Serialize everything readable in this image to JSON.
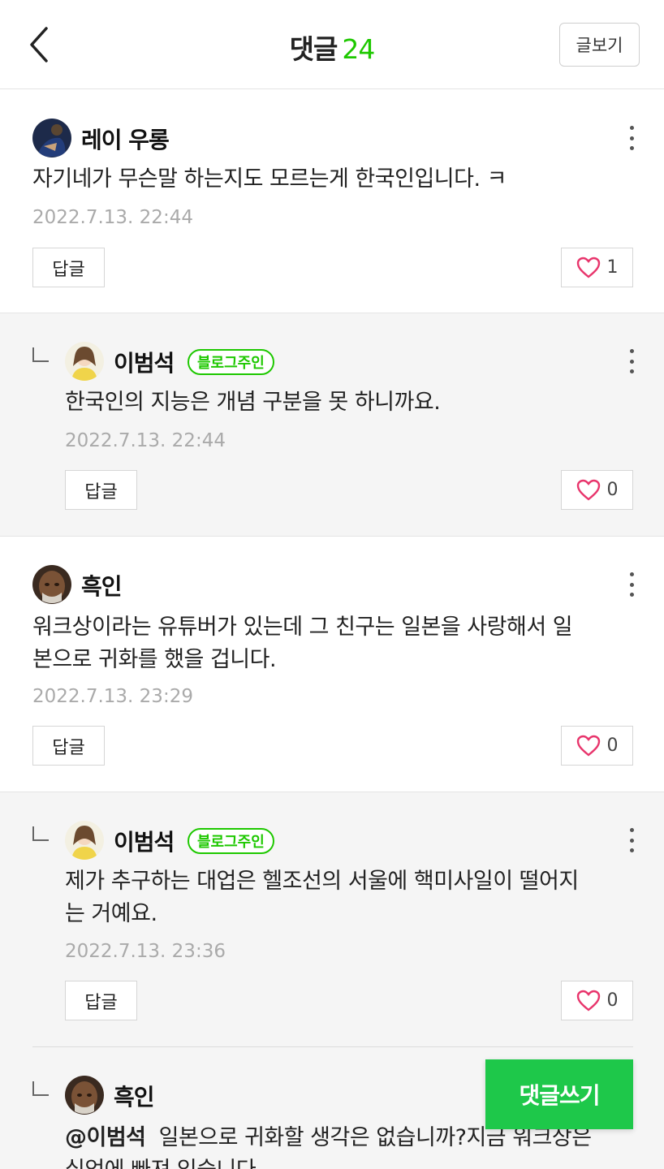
{
  "header": {
    "title": "댓글",
    "count": "24",
    "view_post": "글보기"
  },
  "comments": [
    {
      "author": "레이 우롱",
      "text": "자기네가 무슨말 하는지도 모르는게 한국인입니다. ㅋ",
      "date": "2022.7.13. 22:44",
      "reply_label": "답글",
      "likes": "1"
    },
    {
      "author": "이범석",
      "badge": "블로그주인",
      "text": "한국인의 지능은 개념 구분을 못 하니까요.",
      "date": "2022.7.13. 22:44",
      "reply_label": "답글",
      "likes": "0"
    },
    {
      "author": "흑인",
      "text_line1": "워크상이라는 유튜버가 있는데 그 친구는 일본을 사랑해서 일",
      "text_line2": "본으로 귀화를 했을 겁니다.",
      "date": "2022.7.13. 23:29",
      "reply_label": "답글",
      "likes": "0"
    },
    {
      "author": "이범석",
      "badge": "블로그주인",
      "text_line1": "제가 추구하는 대업은 헬조선의 서울에 핵미사일이 떨어지",
      "text_line2": "는 거예요.",
      "date": "2022.7.13. 23:36",
      "reply_label": "답글",
      "likes": "0"
    },
    {
      "author": "흑인",
      "mention": "@이범석",
      "text_line1": "일본으로 귀화할 생각은 없습니까?지금 워크상은",
      "text_line2": "십억에 빠져 있습니다"
    }
  ],
  "write_button": "댓글쓰기",
  "colors": {
    "accent_green": "#1ec800",
    "write_button_bg": "#1ec84a",
    "heart_pink": "#e8356c"
  },
  "icons": [
    "back-chevron-icon",
    "more-vertical-icon",
    "heart-icon",
    "reply-indent-icon"
  ]
}
